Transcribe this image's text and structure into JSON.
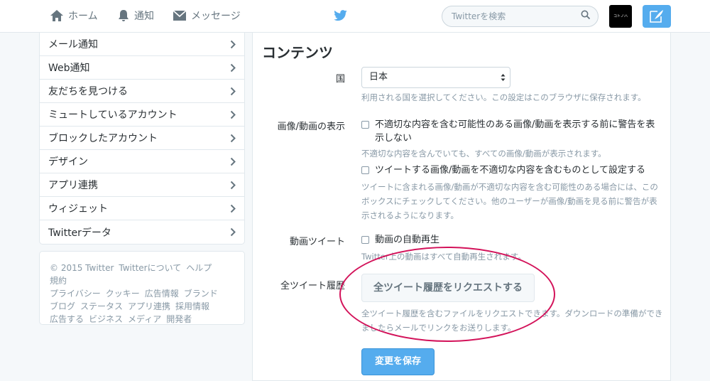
{
  "nav": {
    "home": "ホーム",
    "notifications": "通知",
    "messages": "メッセージ"
  },
  "search": {
    "placeholder": "Twitterを検索"
  },
  "avatar_text": "コトノハ",
  "sidebar": {
    "items": [
      {
        "label": "メール通知"
      },
      {
        "label": "Web通知"
      },
      {
        "label": "友だちを見つける"
      },
      {
        "label": "ミュートしているアカウント"
      },
      {
        "label": "ブロックしたアカウント"
      },
      {
        "label": "デザイン"
      },
      {
        "label": "アプリ連携"
      },
      {
        "label": "ウィジェット"
      },
      {
        "label": "Twitterデータ"
      }
    ]
  },
  "footer": {
    "links": [
      "© 2015 Twitter",
      "Twitterについて",
      "ヘルプ",
      "規約",
      "プライバシー",
      "クッキー",
      "広告情報",
      "ブランド",
      "ブログ",
      "ステータス",
      "アプリ連携",
      "採用情報",
      "広告する",
      "ビジネス",
      "メディア",
      "開発者"
    ]
  },
  "main": {
    "heading": "コンテンツ",
    "country": {
      "label": "国",
      "value": "日本",
      "help": "利用される国を選択してください。この設定はこのブラウザに保存されます。"
    },
    "media": {
      "label": "画像/動画の表示",
      "option1": "不適切な内容を含む可能性のある画像/動画を表示する前に警告を表示しない",
      "option1_help": "不適切な内容を含んでいても、すべての画像/動画が表示されます。",
      "option2": "ツイートする画像/動画を不適切な内容を含むものとして設定する",
      "option2_help": "ツイートに含まれる画像/動画が不適切な内容を含む可能性のある場合には、このボックスにチェックしてください。他のユーザーが画像/動画を見る前に警告が表示されるようになります。"
    },
    "video": {
      "label": "動画ツイート",
      "option": "動画の自動再生",
      "help": "Twitter上の動画はすべて自動再生されます。"
    },
    "archive": {
      "label": "全ツイート履歴",
      "button": "全ツイート履歴をリクエストする",
      "help": "全ツイート履歴を含むファイルをリクエストできます。ダウンロードの準備ができましたらメールでリンクをお送りします。"
    },
    "save_button": "変更を保存"
  },
  "colors": {
    "accent": "#55acee",
    "highlight": "#d3135a"
  }
}
